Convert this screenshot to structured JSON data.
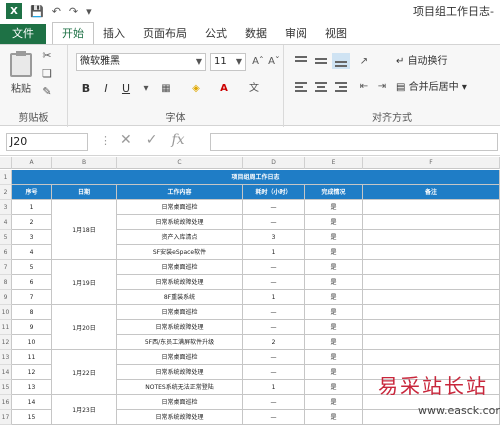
{
  "window": {
    "title": "项目组工作日志-"
  },
  "tabs": [
    "文件",
    "开始",
    "插入",
    "页面布局",
    "公式",
    "数据",
    "审阅",
    "视图"
  ],
  "ribbon": {
    "clipboard": {
      "paste": "粘贴",
      "label": "剪贴板"
    },
    "font": {
      "name": "微软雅黑",
      "size": "11",
      "label": "字体",
      "bold": "B",
      "italic": "I",
      "underline": "U"
    },
    "alignment": {
      "wrap": "自动换行",
      "merge": "合并后居中",
      "label": "对齐方式"
    }
  },
  "formula_bar": {
    "name_box": "J20",
    "fx": "fx"
  },
  "columns": [
    "A",
    "B",
    "C",
    "D",
    "E",
    "F"
  ],
  "sheet": {
    "title": "项目组周工作日志",
    "headers": [
      "序号",
      "日期",
      "工作内容",
      "耗时（小时）",
      "完成情况",
      "备注"
    ],
    "rows": [
      {
        "n": "1",
        "date": "",
        "task": "日常桌面巡检",
        "time": "—",
        "status": "是"
      },
      {
        "n": "2",
        "date": "1月18日",
        "task": "日常系统故障处理",
        "time": "—",
        "status": "是"
      },
      {
        "n": "3",
        "date": "",
        "task": "资产入库清点",
        "time": "3",
        "status": "是"
      },
      {
        "n": "4",
        "date": "",
        "task": "SF安装eSpace软件",
        "time": "1",
        "status": "是"
      },
      {
        "n": "5",
        "date": "",
        "task": "日常桌面巡检",
        "time": "—",
        "status": "是"
      },
      {
        "n": "6",
        "date": "1月19日",
        "task": "日常系统故障处理",
        "time": "—",
        "status": "是"
      },
      {
        "n": "7",
        "date": "",
        "task": "8F重装系统",
        "time": "1",
        "status": "是"
      },
      {
        "n": "8",
        "date": "",
        "task": "日常桌面巡检",
        "time": "—",
        "status": "是"
      },
      {
        "n": "9",
        "date": "1月20日",
        "task": "日常系统故障处理",
        "time": "—",
        "status": "是"
      },
      {
        "n": "10",
        "date": "",
        "task": "5F西/东员工满屏软件升级",
        "time": "2",
        "status": "是"
      },
      {
        "n": "11",
        "date": "",
        "task": "日常桌面巡检",
        "time": "—",
        "status": "是"
      },
      {
        "n": "12",
        "date": "1月22日",
        "task": "日常系统故障处理",
        "time": "—",
        "status": "是"
      },
      {
        "n": "13",
        "date": "",
        "task": "NOTES系统无法正常登陆",
        "time": "1",
        "status": "是"
      },
      {
        "n": "14",
        "date": "",
        "task": "日常桌面巡检",
        "time": "—",
        "status": "是"
      },
      {
        "n": "15",
        "date": "1月23日",
        "task": "日常系统故障处理",
        "time": "—",
        "status": "是"
      }
    ],
    "row_labels": [
      "1",
      "2",
      "3",
      "4",
      "5",
      "6",
      "7",
      "8",
      "9",
      "10",
      "11",
      "12",
      "13",
      "14",
      "15",
      "16",
      "17"
    ]
  },
  "watermark": {
    "text": "易采站长站",
    "url": "www.easck.com"
  }
}
